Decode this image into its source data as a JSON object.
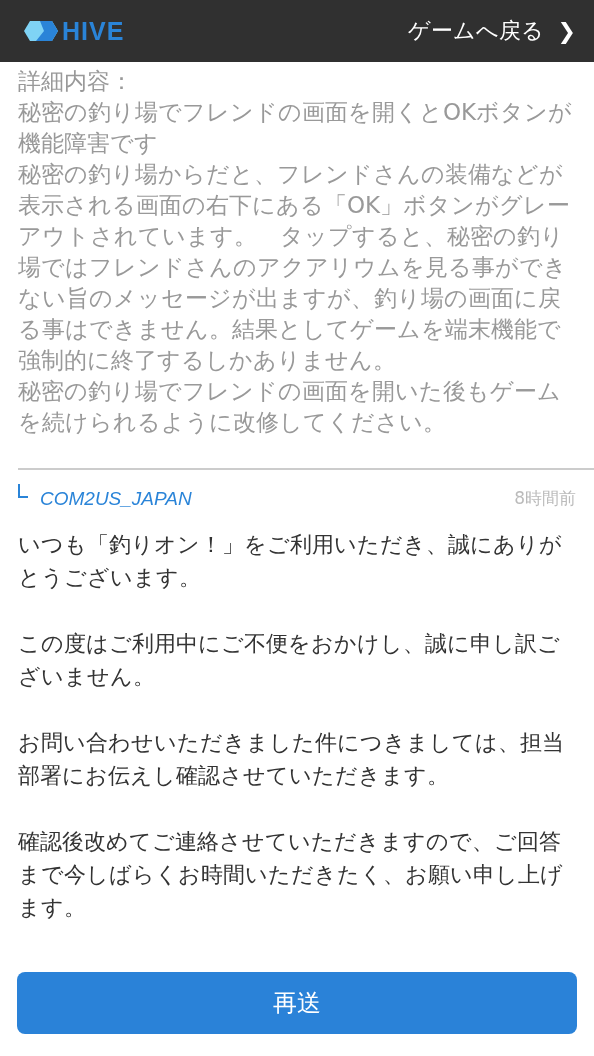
{
  "header": {
    "logo_text": "HIVE",
    "back_link": "ゲームへ戻る",
    "back_arrow": "❯"
  },
  "inquiry": {
    "paragraphs": [
      "詳細内容：",
      "秘密の釣り場でフレンドの画面を開くとOKボタンが機能障害です",
      "秘密の釣り場からだと、フレンドさんの装備などが表示される画面の右下にある「OK」ボタンがグレーアウトされています。　タップすると、秘密の釣り場ではフレンドさんのアクアリウムを見る事ができない旨のメッセージが出ますが、釣り場の画面に戻る事はできません。結果としてゲームを端末機能で強制的に終了するしかありません。",
      "秘密の釣り場でフレンドの画面を開いた後もゲームを続けられるように改修してください。"
    ]
  },
  "reply": {
    "author": "COM2US_JAPAN",
    "time": "8時間前",
    "paragraphs": [
      "いつも「釣りオン！」をご利用いただき、誠にありがとうございます。",
      "この度はご利用中にご不便をおかけし、誠に申し訳ございません。",
      "お問い合わせいただきました件につきましては、担当部署にお伝えし確認させていただきます。",
      "確認後改めてご連絡させていただきますので、ご回答まで今しばらくお時間いただきたく、お願い申し上げます。"
    ]
  },
  "resend_button": "再送"
}
